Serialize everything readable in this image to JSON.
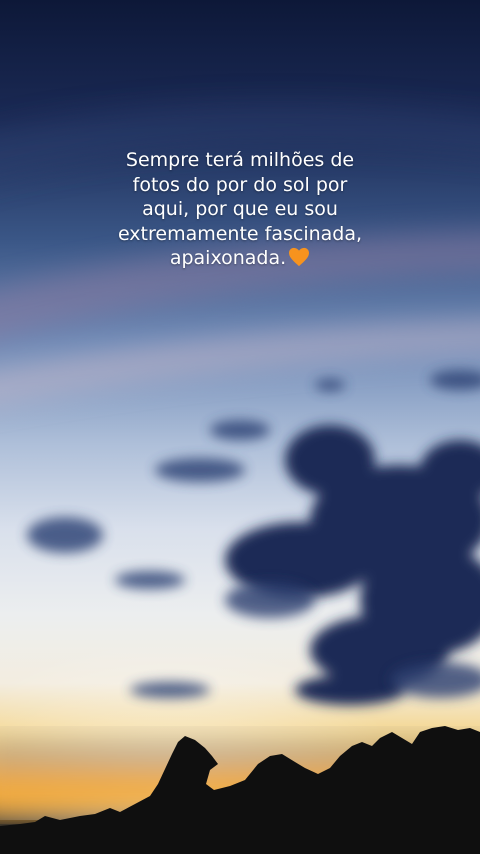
{
  "caption": {
    "text": "Sempre terá milhões de\nfotos do por do sol por\naqui, por que eu sou\nextremamente fascinada,\napaixonada.",
    "emoji": "orange-heart-icon"
  },
  "colors": {
    "sky_top": "#0d1838",
    "sky_mid": "#6f8ab6",
    "horizon_glow": "#f0b54a",
    "cloud_dark": "#1c2a56",
    "heart": "#f7931e"
  }
}
